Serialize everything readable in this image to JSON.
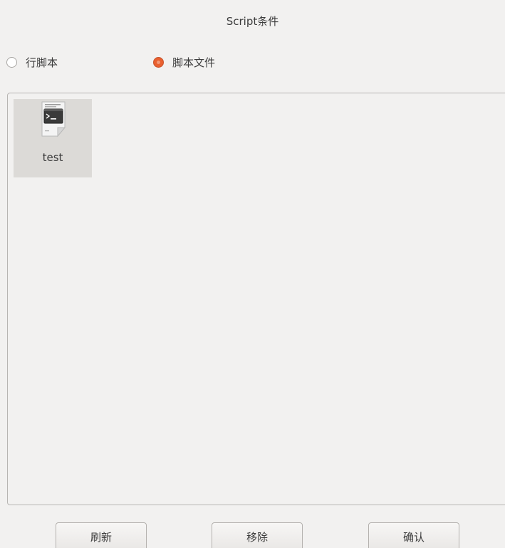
{
  "window": {
    "title": "Script条件"
  },
  "radio_group": {
    "options": [
      {
        "label": "行脚本",
        "checked": false
      },
      {
        "label": "脚本文件",
        "checked": true
      }
    ]
  },
  "file_list": {
    "items": [
      {
        "name": "test",
        "icon": "terminal-script-file-icon",
        "selected": true
      }
    ]
  },
  "buttons": {
    "refresh_label": "刷新",
    "remove_label": "移除",
    "confirm_label": "确认"
  },
  "colors": {
    "accent": "#e9602f",
    "background": "#f2f1f0",
    "selection": "#dcdad7"
  }
}
